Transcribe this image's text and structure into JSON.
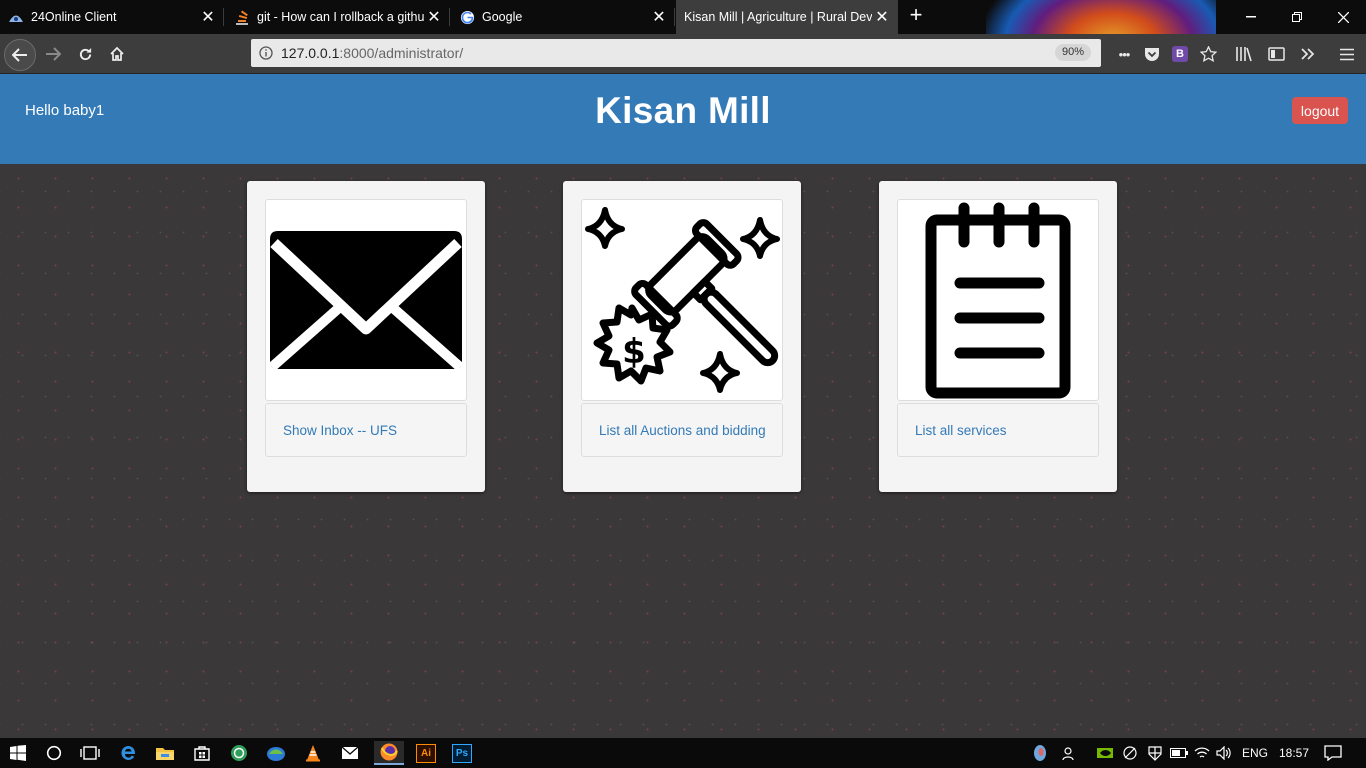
{
  "browser": {
    "tabs": [
      {
        "title": "24Online Client",
        "icon": "24online-icon"
      },
      {
        "title": "git - How can I rollback a githu",
        "icon": "stackoverflow-icon"
      },
      {
        "title": "Google",
        "icon": "google-icon"
      },
      {
        "title": "Kisan Mill | Agriculture | Rural Deve",
        "icon": "none"
      }
    ],
    "new_tab_label": "+",
    "url_host": "127.0.0.1",
    "url_path": ":8000/administrator/",
    "zoom": "90%",
    "page_actions_label": "•••",
    "bootstrap_badge": "B"
  },
  "page": {
    "greeting": "Hello baby1",
    "title": "Kisan Mill",
    "logout_label": "logout",
    "cards": [
      {
        "icon": "envelope-icon",
        "link_label": "Show Inbox -- UFS"
      },
      {
        "icon": "auction-gavel-icon",
        "link_label": "List all Auctions and bidding"
      },
      {
        "icon": "notepad-icon",
        "link_label": "List all services"
      }
    ]
  },
  "taskbar": {
    "language": "ENG",
    "time": "18:57",
    "apps": [
      "start-icon",
      "search-icon",
      "task-view-icon",
      "edge-icon",
      "file-explorer-icon",
      "store-icon",
      "app-green-icon",
      "app-globe-icon",
      "vlc-icon",
      "mail-icon",
      "firefox-icon",
      "illustrator-icon",
      "photoshop-icon"
    ],
    "illustrator_label": "Ai",
    "photoshop_label": "Ps"
  },
  "colors": {
    "header_blue": "#337ab7",
    "logout_red": "#d9534f",
    "link_blue": "#337ab7",
    "page_bg": "#3a3838"
  }
}
